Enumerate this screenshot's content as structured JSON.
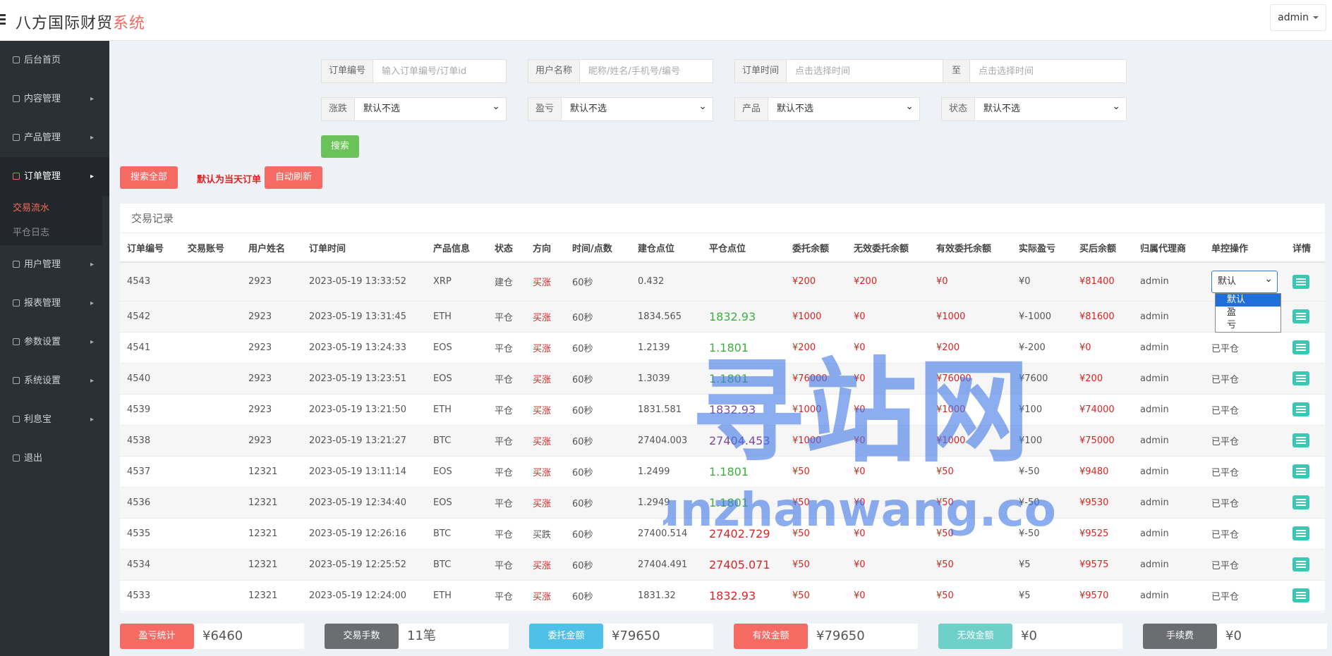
{
  "header": {
    "brand_main": "八方国际财贸",
    "brand_hl": "系统",
    "user": "admin"
  },
  "sidebar": {
    "items": [
      {
        "label": "后台首页",
        "arrow": ""
      },
      {
        "label": "内容管理",
        "arrow": "▸"
      },
      {
        "label": "产品管理",
        "arrow": "▸"
      },
      {
        "label": "订单管理",
        "arrow": "▸"
      },
      {
        "label": "用户管理",
        "arrow": "▸"
      },
      {
        "label": "报表管理",
        "arrow": "▸"
      },
      {
        "label": "参数设置",
        "arrow": "▸"
      },
      {
        "label": "系统设置",
        "arrow": "▸"
      },
      {
        "label": "利息宝",
        "arrow": "▸"
      },
      {
        "label": "退出",
        "arrow": ""
      }
    ],
    "sub_items": [
      "交易流水",
      "平仓日志"
    ]
  },
  "filters": {
    "order_no": {
      "label": "订单编号",
      "placeholder": "输入订单编号/订单id"
    },
    "username": {
      "label": "用户名称",
      "placeholder": "昵称/姓名/手机号/编号"
    },
    "order_time": {
      "label": "订单时间",
      "placeholder_from": "点击选择时间",
      "to": "至",
      "placeholder_to": "点击选择时间"
    },
    "rise_fall": {
      "label": "涨跌",
      "value": "默认不选"
    },
    "profit_loss": {
      "label": "盈亏",
      "value": "默认不选"
    },
    "product": {
      "label": "产品",
      "value": "默认不选"
    },
    "status": {
      "label": "状态",
      "value": "默认不选"
    },
    "search_btn": "搜索"
  },
  "actions": {
    "search_all": "搜索全部",
    "notice": "默认为当天订单",
    "auto_refresh": "自动刷新"
  },
  "panel": {
    "title": "交易记录",
    "columns": [
      "订单编号",
      "交易账号",
      "用户姓名",
      "订单时间",
      "产品信息",
      "状态",
      "方向",
      "时间/点数",
      "建仓点位",
      "平仓点位",
      "委托余额",
      "无效委托余额",
      "有效委托余额",
      "实际盈亏",
      "买后余额",
      "归属代理商",
      "单控操作",
      "详情"
    ],
    "rows": [
      {
        "id": "4543",
        "account": "",
        "name": "2923",
        "time": "2023-05-19 13:33:52",
        "product": "XRP",
        "status": "建仓",
        "dir": "买涨",
        "period": "60秒",
        "open": "0.432",
        "close": "",
        "entrust": "¥200",
        "invalid": "¥200",
        "valid": "¥0",
        "pnl": "¥0",
        "after": "¥81400",
        "agent": "admin",
        "ctl": "默认"
      },
      {
        "id": "4542",
        "account": "",
        "name": "2923",
        "time": "2023-05-19 13:31:45",
        "product": "ETH",
        "status": "平仓",
        "dir": "买涨",
        "period": "60秒",
        "open": "1834.565",
        "close": "1832.93",
        "entrust": "¥1000",
        "invalid": "¥0",
        "valid": "¥1000",
        "pnl": "¥-1000",
        "after": "¥81600",
        "agent": "admin",
        "ctl": ""
      },
      {
        "id": "4541",
        "account": "",
        "name": "2923",
        "time": "2023-05-19 13:24:33",
        "product": "EOS",
        "status": "平仓",
        "dir": "买涨",
        "period": "60秒",
        "open": "1.2139",
        "close": "1.1801",
        "entrust": "¥200",
        "invalid": "¥0",
        "valid": "¥200",
        "pnl": "¥-200",
        "after": "¥0",
        "agent": "admin",
        "ctl": "已平仓"
      },
      {
        "id": "4540",
        "account": "",
        "name": "2923",
        "time": "2023-05-19 13:23:51",
        "product": "EOS",
        "status": "平仓",
        "dir": "买涨",
        "period": "60秒",
        "open": "1.3039",
        "close": "1.1801",
        "entrust": "¥76000",
        "invalid": "¥0",
        "valid": "¥76000",
        "pnl": "¥7600",
        "after": "¥200",
        "agent": "admin",
        "ctl": "已平仓"
      },
      {
        "id": "4539",
        "account": "",
        "name": "2923",
        "time": "2023-05-19 13:21:50",
        "product": "ETH",
        "status": "平仓",
        "dir": "买涨",
        "period": "60秒",
        "open": "1831.581",
        "close": "1832.93",
        "entrust": "¥1000",
        "invalid": "¥0",
        "valid": "¥1000",
        "pnl": "¥100",
        "after": "¥74000",
        "agent": "admin",
        "ctl": "已平仓"
      },
      {
        "id": "4538",
        "account": "",
        "name": "2923",
        "time": "2023-05-19 13:21:27",
        "product": "BTC",
        "status": "平仓",
        "dir": "买涨",
        "period": "60秒",
        "open": "27404.003",
        "close": "27404.453",
        "entrust": "¥1000",
        "invalid": "¥0",
        "valid": "¥1000",
        "pnl": "¥100",
        "after": "¥75000",
        "agent": "admin",
        "ctl": "已平仓"
      },
      {
        "id": "4537",
        "account": "",
        "name": "12321",
        "time": "2023-05-19 13:11:14",
        "product": "EOS",
        "status": "平仓",
        "dir": "买涨",
        "period": "60秒",
        "open": "1.2499",
        "close": "1.1801",
        "entrust": "¥50",
        "invalid": "¥0",
        "valid": "¥50",
        "pnl": "¥-50",
        "after": "¥9480",
        "agent": "admin",
        "ctl": "已平仓"
      },
      {
        "id": "4536",
        "account": "",
        "name": "12321",
        "time": "2023-05-19 12:34:40",
        "product": "EOS",
        "status": "平仓",
        "dir": "买涨",
        "period": "60秒",
        "open": "1.2949",
        "close": "1.1801",
        "entrust": "¥50",
        "invalid": "¥0",
        "valid": "¥50",
        "pnl": "¥-50",
        "after": "¥9530",
        "agent": "admin",
        "ctl": "已平仓"
      },
      {
        "id": "4535",
        "account": "",
        "name": "12321",
        "time": "2023-05-19 12:26:16",
        "product": "BTC",
        "status": "平仓",
        "dir": "买跌",
        "period": "60秒",
        "open": "27400.514",
        "close": "27402.729",
        "entrust": "¥50",
        "invalid": "¥0",
        "valid": "¥50",
        "pnl": "¥-50",
        "after": "¥9525",
        "agent": "admin",
        "ctl": "已平仓"
      },
      {
        "id": "4534",
        "account": "",
        "name": "12321",
        "time": "2023-05-19 12:25:52",
        "product": "BTC",
        "status": "平仓",
        "dir": "买涨",
        "period": "60秒",
        "open": "27404.491",
        "close": "27405.071",
        "entrust": "¥50",
        "invalid": "¥0",
        "valid": "¥50",
        "pnl": "¥5",
        "after": "¥9575",
        "agent": "admin",
        "ctl": "已平仓"
      },
      {
        "id": "4533",
        "account": "",
        "name": "12321",
        "time": "2023-05-19 12:24:00",
        "product": "ETH",
        "status": "平仓",
        "dir": "买涨",
        "period": "60秒",
        "open": "1831.32",
        "close": "1832.93",
        "entrust": "¥50",
        "invalid": "¥0",
        "valid": "¥50",
        "pnl": "¥5",
        "after": "¥9570",
        "agent": "admin",
        "ctl": "已平仓"
      }
    ],
    "dropdown_options": [
      "默认",
      "盈",
      "亏"
    ]
  },
  "stats": [
    {
      "label": "盈亏统计",
      "value": "¥6460",
      "color": "#f56b63"
    },
    {
      "label": "交易手数",
      "value": "11笔",
      "color": "#6b6d70"
    },
    {
      "label": "委托金额",
      "value": "¥79650",
      "color": "#4fc1e9"
    },
    {
      "label": "有效金额",
      "value": "¥79650",
      "color": "#f56b63"
    },
    {
      "label": "无效金额",
      "value": "¥0",
      "color": "#6fcfc9"
    },
    {
      "label": "手续费",
      "value": "¥0",
      "color": "#6b6d70"
    }
  ],
  "watermark": {
    "line1": "寻站网",
    "line2": "xunzhanwang.com"
  },
  "colors": {
    "accent": "#f56b63",
    "green_btn": "#6ac259",
    "detail": "#3cc7b5",
    "sidebar": "#2b3035"
  }
}
